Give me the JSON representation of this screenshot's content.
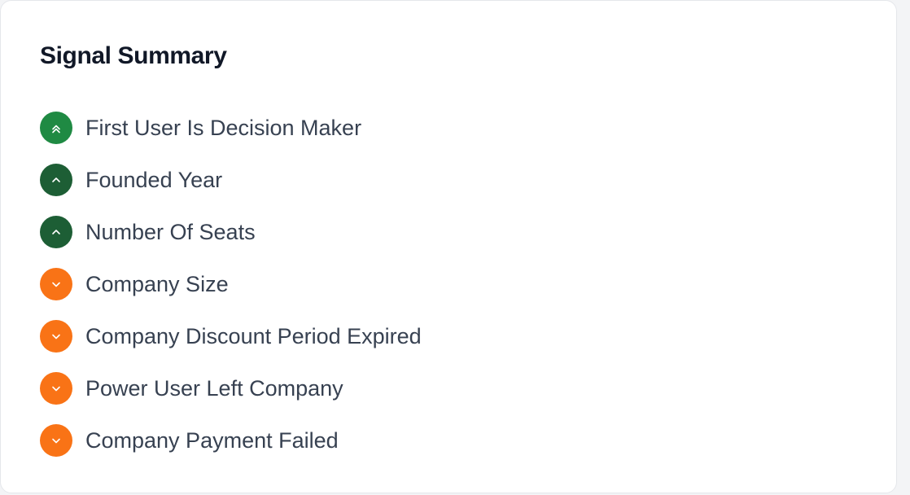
{
  "card": {
    "title": "Signal Summary"
  },
  "colors": {
    "strong_positive": "#1f8a43",
    "positive": "#1d5e35",
    "negative": "#f97316"
  },
  "signals": [
    {
      "label": "First User Is Decision Maker",
      "icon": "double-chevron-up-icon",
      "polarity": "strong_positive"
    },
    {
      "label": "Founded Year",
      "icon": "chevron-up-icon",
      "polarity": "positive"
    },
    {
      "label": "Number Of Seats",
      "icon": "chevron-up-icon",
      "polarity": "positive"
    },
    {
      "label": "Company Size",
      "icon": "chevron-down-icon",
      "polarity": "negative"
    },
    {
      "label": "Company Discount Period Expired",
      "icon": "chevron-down-icon",
      "polarity": "negative"
    },
    {
      "label": "Power User Left Company",
      "icon": "chevron-down-icon",
      "polarity": "negative"
    },
    {
      "label": "Company Payment Failed",
      "icon": "chevron-down-icon",
      "polarity": "negative"
    }
  ]
}
